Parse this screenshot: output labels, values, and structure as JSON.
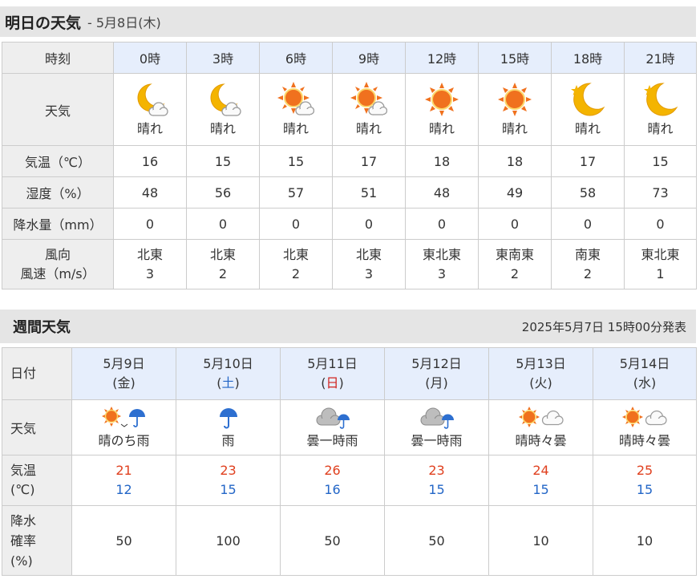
{
  "tomorrow": {
    "title": "明日の天気",
    "subtitle": "- 5月8日(木)",
    "row_labels": {
      "time": "時刻",
      "weather": "天気",
      "temp": "気温（℃）",
      "humidity": "湿度（%）",
      "precip": "降水量（mm）",
      "wind_dir": "風向",
      "wind_speed": "風速（m/s）"
    },
    "hours": [
      {
        "time": "0時",
        "icon": "moon-cloud-icon",
        "weather": "晴れ",
        "temp": "16",
        "humidity": "48",
        "precip": "0",
        "wind_dir": "北東",
        "wind_speed": "3"
      },
      {
        "time": "3時",
        "icon": "moon-cloud-icon",
        "weather": "晴れ",
        "temp": "15",
        "humidity": "56",
        "precip": "0",
        "wind_dir": "北東",
        "wind_speed": "2"
      },
      {
        "time": "6時",
        "icon": "sun-cloud-icon",
        "weather": "晴れ",
        "temp": "15",
        "humidity": "57",
        "precip": "0",
        "wind_dir": "北東",
        "wind_speed": "2"
      },
      {
        "time": "9時",
        "icon": "sun-cloud-icon",
        "weather": "晴れ",
        "temp": "17",
        "humidity": "51",
        "precip": "0",
        "wind_dir": "北東",
        "wind_speed": "3"
      },
      {
        "time": "12時",
        "icon": "sun-icon",
        "weather": "晴れ",
        "temp": "18",
        "humidity": "48",
        "precip": "0",
        "wind_dir": "東北東",
        "wind_speed": "3"
      },
      {
        "time": "15時",
        "icon": "sun-icon",
        "weather": "晴れ",
        "temp": "18",
        "humidity": "49",
        "precip": "0",
        "wind_dir": "東南東",
        "wind_speed": "2"
      },
      {
        "time": "18時",
        "icon": "moon-star-icon",
        "weather": "晴れ",
        "temp": "17",
        "humidity": "58",
        "precip": "0",
        "wind_dir": "南東",
        "wind_speed": "2"
      },
      {
        "time": "21時",
        "icon": "moon-star-icon",
        "weather": "晴れ",
        "temp": "15",
        "humidity": "73",
        "precip": "0",
        "wind_dir": "東北東",
        "wind_speed": "1"
      }
    ]
  },
  "weekly": {
    "title": "週間天気",
    "published": "2025年5月7日 15時00分発表",
    "row_labels": {
      "date": "日付",
      "weather": "天気",
      "temp_1": "気温",
      "temp_2": "(℃)",
      "rain_1": "降水",
      "rain_2": "確率",
      "rain_3": "(%)"
    },
    "days": [
      {
        "date": "5月9日",
        "dow": "(金)",
        "icon": "sun-then-rain-icon",
        "weather": "晴のち雨",
        "high": "21",
        "low": "12",
        "rain": "50"
      },
      {
        "date": "5月10日",
        "dow": "(土)",
        "icon": "umbrella-icon",
        "weather": "雨",
        "high": "23",
        "low": "15",
        "rain": "100"
      },
      {
        "date": "5月11日",
        "dow": "(日)",
        "icon": "cloud-umbrella-icon",
        "weather": "曇一時雨",
        "high": "26",
        "low": "16",
        "rain": "50"
      },
      {
        "date": "5月12日",
        "dow": "(月)",
        "icon": "cloud-umbrella-icon",
        "weather": "曇一時雨",
        "high": "23",
        "low": "15",
        "rain": "50"
      },
      {
        "date": "5月13日",
        "dow": "(火)",
        "icon": "sun-cloud-icon",
        "weather": "晴時々曇",
        "high": "24",
        "low": "15",
        "rain": "10"
      },
      {
        "date": "5月14日",
        "dow": "(水)",
        "icon": "sun-cloud-icon",
        "weather": "晴時々曇",
        "high": "25",
        "low": "15",
        "rain": "10"
      }
    ]
  },
  "colors": {
    "header_bg": "#e5e5e5",
    "column_header_bg": "#e6eefc",
    "row_label_bg": "#eeeeee",
    "high_temp": "#e0401f",
    "low_temp": "#2366c7",
    "sunday": "#d0231f",
    "saturday": "#2366c7"
  }
}
